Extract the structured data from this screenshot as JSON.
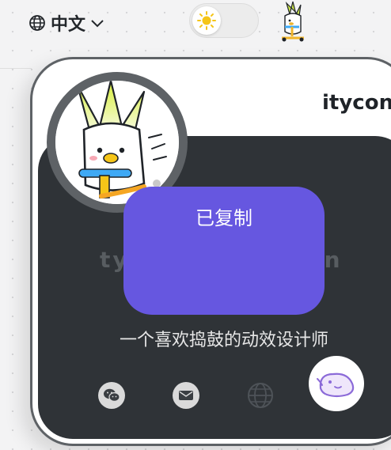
{
  "header": {
    "language_label": "中文",
    "theme": "light"
  },
  "card": {
    "username": "itycon",
    "domain_left": "ty",
    "domain_right": "cn",
    "bio": "一个喜欢捣鼓的动效设计师"
  },
  "toast": {
    "message": "已复制"
  },
  "colors": {
    "toast_bg": "#6657e0",
    "card_border": "#5e6266",
    "card_inner_bg": "#2f3337",
    "fab_accent": "#8b6ad8"
  },
  "social": [
    {
      "name": "wechat",
      "icon": "wechat-icon"
    },
    {
      "name": "mail",
      "icon": "mail-icon"
    },
    {
      "name": "website",
      "icon": "globe-icon"
    }
  ]
}
